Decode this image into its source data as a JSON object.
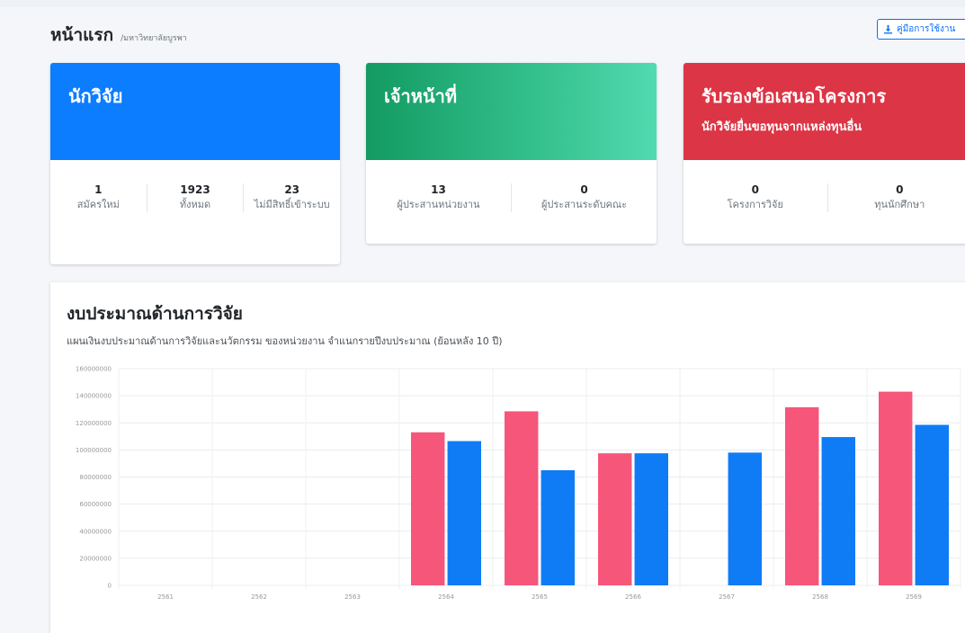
{
  "header": {
    "title": "หน้าแรก",
    "breadcrumb": "/มหาวิทยาลัยบูรพา",
    "manual_button": "คู่มือการใช้งาน"
  },
  "cards": {
    "researcher": {
      "title": "นักวิจัย",
      "stats": [
        {
          "value": "1",
          "label": "สมัครใหม่"
        },
        {
          "value": "1923",
          "label": "ทั้งหมด"
        },
        {
          "value": "23",
          "label": "ไม่มีสิทธิ์เข้าระบบ"
        }
      ]
    },
    "staff": {
      "title": "เจ้าหน้าที่",
      "stats": [
        {
          "value": "13",
          "label": "ผู้ประสานหน่วยงาน"
        },
        {
          "value": "0",
          "label": "ผู้ประสานระดับคณะ"
        }
      ]
    },
    "endorse": {
      "title": "รับรองข้อเสนอโครงการ",
      "subtitle": "นักวิจัยยื่นขอทุนจากแหล่งทุนอื่น",
      "stats": [
        {
          "value": "0",
          "label": "โครงการวิจัย"
        },
        {
          "value": "0",
          "label": "ทุนนักศึกษา"
        }
      ]
    }
  },
  "chart_section": {
    "title": "งบประมาณด้านการวิจัย",
    "subtitle": "แผนเงินงบประมาณด้านการวิจัยและนวัตกรรม ของหน่วยงาน จำแนกรายปีงบประมาณ (ย้อนหลัง 10 ปี)"
  },
  "chart_data": {
    "type": "bar",
    "categories": [
      "2561",
      "2562",
      "2563",
      "2564",
      "2565",
      "2566",
      "2567",
      "2568",
      "2569"
    ],
    "series": [
      {
        "color": "#f5567a",
        "values": [
          0,
          0,
          0,
          113000000,
          128500000,
          97500000,
          0,
          131500000,
          143000000
        ]
      },
      {
        "color": "#0f7cf5",
        "values": [
          0,
          0,
          0,
          106500000,
          85000000,
          97500000,
          98000000,
          109500000,
          118500000
        ]
      }
    ],
    "yticks": [
      "0",
      "20000000",
      "40000000",
      "60000000",
      "80000000",
      "100000000",
      "120000000",
      "140000000",
      "160000000"
    ],
    "ylim": [
      0,
      160000000
    ],
    "grid": true
  }
}
